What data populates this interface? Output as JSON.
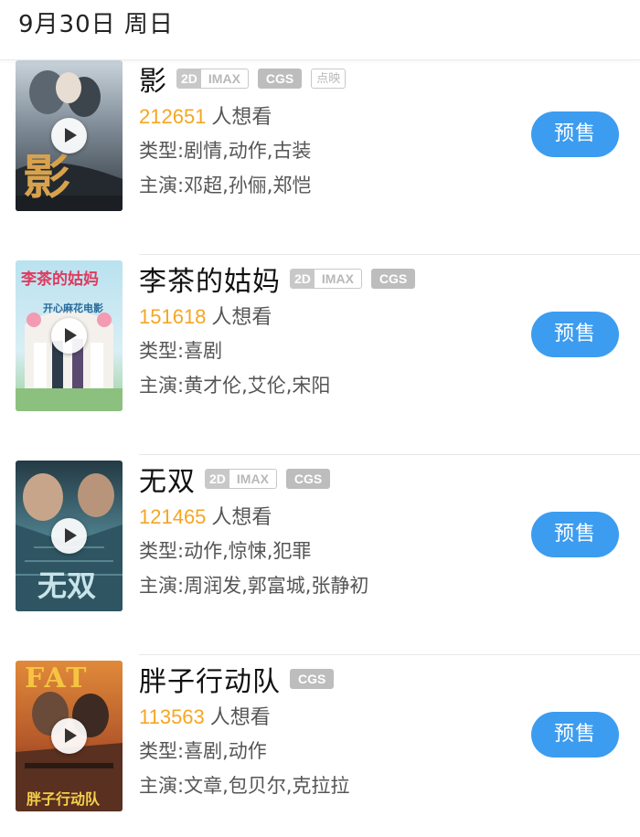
{
  "header": {
    "date": "9月30日 周日"
  },
  "tags_text": {
    "d2": "2D",
    "imax": "IMAX",
    "cgs": "CGS",
    "dianying": "点映"
  },
  "movies": [
    {
      "title": "影",
      "want_count": "212651",
      "want_suffix": "人想看",
      "genre": "类型:剧情,动作,古装",
      "cast": "主演:邓超,孙俪,郑恺",
      "presale_label": "预售",
      "poster_title": "影",
      "colors": {
        "poster_main": "#4a5560",
        "poster_accent": "#c8a070"
      }
    },
    {
      "title": "李茶的姑妈",
      "want_count": "151618",
      "want_suffix": "人想看",
      "genre": "类型:喜剧",
      "cast": "主演:黄才伦,艾伦,宋阳",
      "presale_label": "预售",
      "poster_title": "李茶的姑妈",
      "poster_subtitle": "开心麻花电影",
      "colors": {
        "poster_main": "#8fc9e0",
        "poster_accent": "#e25a7a"
      }
    },
    {
      "title": "无双",
      "want_count": "121465",
      "want_suffix": "人想看",
      "genre": "类型:动作,惊悚,犯罪",
      "cast": "主演:周润发,郭富城,张静初",
      "presale_label": "预售",
      "poster_title": "无双",
      "colors": {
        "poster_main": "#3f6a78",
        "poster_accent": "#9ec6cf"
      }
    },
    {
      "title": "胖子行动队",
      "want_count": "113563",
      "want_suffix": "人想看",
      "genre": "类型:喜剧,动作",
      "cast": "主演:文章,包贝尔,克拉拉",
      "presale_label": "预售",
      "poster_title": "胖子行动队",
      "poster_badge": "FAT",
      "colors": {
        "poster_main": "#c96a2a",
        "poster_accent": "#f2c040"
      }
    }
  ],
  "colors": {
    "accent": "#3c9cf0",
    "want_number": "#f5a623",
    "tag_gray": "#bdbdbd"
  }
}
